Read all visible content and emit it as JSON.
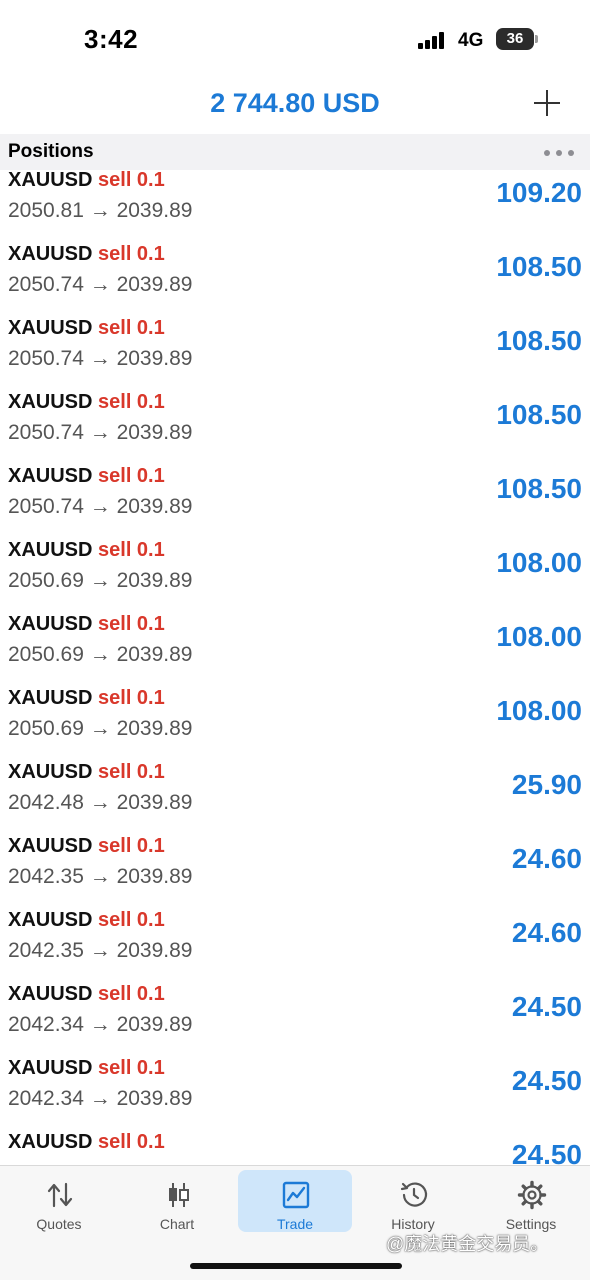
{
  "status_bar": {
    "time": "3:42",
    "network": "4G",
    "battery": "36"
  },
  "header": {
    "balance": "2 744.80 USD"
  },
  "section": {
    "title": "Positions"
  },
  "positions": [
    {
      "symbol": "XAUUSD",
      "side": "sell 0.1",
      "prices": "2050.81 → 2039.89",
      "profit": "109.20"
    },
    {
      "symbol": "XAUUSD",
      "side": "sell 0.1",
      "prices": "2050.74 → 2039.89",
      "profit": "108.50"
    },
    {
      "symbol": "XAUUSD",
      "side": "sell 0.1",
      "prices": "2050.74 → 2039.89",
      "profit": "108.50"
    },
    {
      "symbol": "XAUUSD",
      "side": "sell 0.1",
      "prices": "2050.74 → 2039.89",
      "profit": "108.50"
    },
    {
      "symbol": "XAUUSD",
      "side": "sell 0.1",
      "prices": "2050.74 → 2039.89",
      "profit": "108.50"
    },
    {
      "symbol": "XAUUSD",
      "side": "sell 0.1",
      "prices": "2050.69 → 2039.89",
      "profit": "108.00"
    },
    {
      "symbol": "XAUUSD",
      "side": "sell 0.1",
      "prices": "2050.69 → 2039.89",
      "profit": "108.00"
    },
    {
      "symbol": "XAUUSD",
      "side": "sell 0.1",
      "prices": "2050.69 → 2039.89",
      "profit": "108.00"
    },
    {
      "symbol": "XAUUSD",
      "side": "sell 0.1",
      "prices": "2042.48 → 2039.89",
      "profit": "25.90"
    },
    {
      "symbol": "XAUUSD",
      "side": "sell 0.1",
      "prices": "2042.35 → 2039.89",
      "profit": "24.60"
    },
    {
      "symbol": "XAUUSD",
      "side": "sell 0.1",
      "prices": "2042.35 → 2039.89",
      "profit": "24.60"
    },
    {
      "symbol": "XAUUSD",
      "side": "sell 0.1",
      "prices": "2042.34 → 2039.89",
      "profit": "24.50"
    },
    {
      "symbol": "XAUUSD",
      "side": "sell 0.1",
      "prices": "2042.34 → 2039.89",
      "profit": "24.50"
    },
    {
      "symbol": "XAUUSD",
      "side": "sell 0.1",
      "prices": "",
      "profit": "24.50"
    }
  ],
  "tabs": [
    {
      "label": "Quotes",
      "icon": "quotes-arrows-icon",
      "active": false
    },
    {
      "label": "Chart",
      "icon": "candlestick-icon",
      "active": false
    },
    {
      "label": "Trade",
      "icon": "trade-chart-icon",
      "active": true
    },
    {
      "label": "History",
      "icon": "history-clock-icon",
      "active": false
    },
    {
      "label": "Settings",
      "icon": "gear-icon",
      "active": false
    }
  ],
  "watermark": "@魔法黄金交易员。",
  "colors": {
    "accent": "#1c7ad6",
    "sell": "#d9382b",
    "active_tab_bg": "#cfe6fa"
  }
}
